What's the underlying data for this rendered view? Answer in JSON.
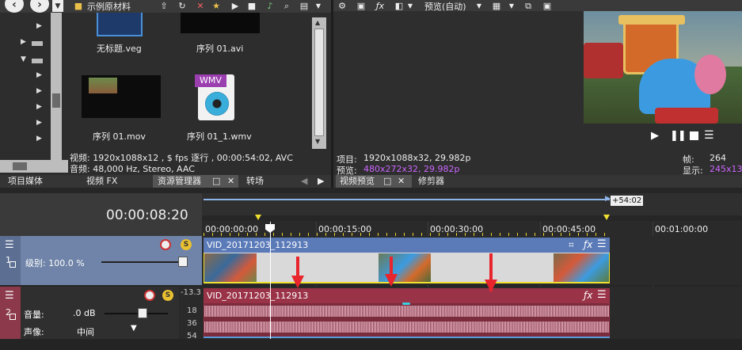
{
  "explorer": {
    "path_label": "示例原材料",
    "files": [
      {
        "name": "无标题.veg",
        "kind": "veg"
      },
      {
        "name": "序列 01.avi",
        "kind": "video"
      },
      {
        "name": "序列 01.mov",
        "kind": "video"
      },
      {
        "name": "序列 01_1.wmv",
        "kind": "wmv"
      }
    ],
    "wmv_badge": "WMV",
    "info_video": "视频: 1920x1088x12 , $ fps 逐行 , 00:00:54:02, AVC",
    "info_audio": "音频: 48,000 Hz, Stereo, AAC"
  },
  "left_tabs": [
    "项目媒体",
    "视频 FX",
    "资源管理器",
    "转场"
  ],
  "preview": {
    "mode_label": "预览(自动)",
    "project_label": "项目:",
    "project_value": "1920x1088x32, 29.982p",
    "preview_label": "预览:",
    "preview_value": "480x272x32, 29.982p",
    "frame_label": "帧:",
    "frame_value": "264",
    "display_label": "显示:",
    "display_value": "245x13",
    "tabs": [
      "视频预览",
      "修剪器"
    ]
  },
  "timeline": {
    "timecode": "00:00:08:20",
    "end_marker": "+54:02",
    "ruler": [
      "00:00:00:00",
      "00:00:15:00",
      "00:00:30:00",
      "00:00:45:00",
      "00:01:00:00"
    ],
    "cursor_fraction": 0.14
  },
  "video_track": {
    "number": "1",
    "level_label": "级别: 100.0 %",
    "level_fraction": 1.0,
    "clip_name": "VID_20171203_112913"
  },
  "audio_track": {
    "number": "2",
    "volume_label": "音量:",
    "volume_value": ".0 dB",
    "pan_label": "声像:",
    "pan_value": "中间",
    "db_scale": [
      "-13.3",
      "18",
      "36",
      "54"
    ],
    "clip_name": "VID_20171203_112913"
  },
  "colors": {
    "video_header": "#6f84a8",
    "video_clip": "#5a7ab8",
    "audio_header": "#8c3a4b",
    "audio_clip": "#9a3348",
    "annotation_arrow": "#e8242c",
    "highlight_value": "#cc66ff"
  }
}
